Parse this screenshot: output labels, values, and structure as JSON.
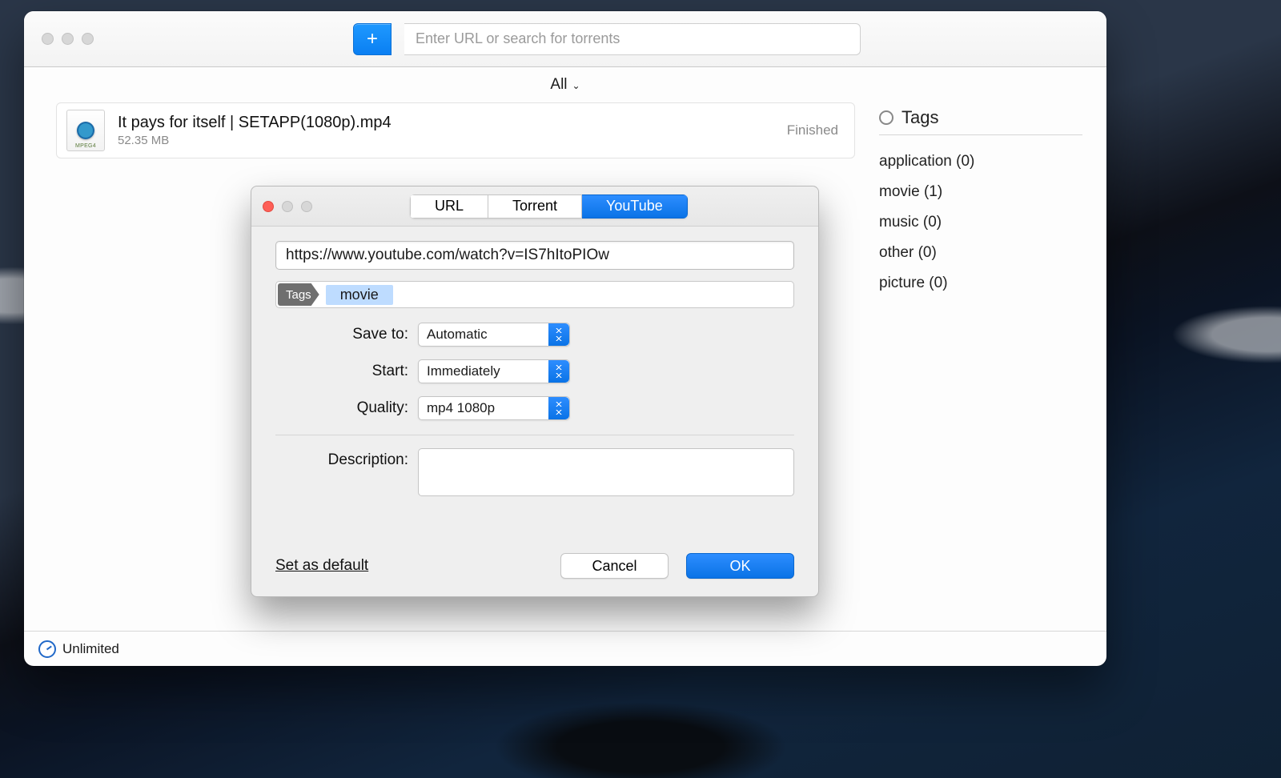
{
  "toolbar": {
    "add_symbol": "+",
    "search_placeholder": "Enter URL or search for torrents"
  },
  "filter": {
    "label": "All"
  },
  "download": {
    "title": "It pays for itself | SETAPP(1080p).mp4",
    "size": "52.35 MB",
    "status": "Finished"
  },
  "sidebar": {
    "heading": "Tags",
    "items": [
      "application (0)",
      "movie (1)",
      "music (0)",
      "other (0)",
      "picture (0)"
    ]
  },
  "bottom": {
    "speed_label": "Unlimited"
  },
  "sheet": {
    "tabs": {
      "url": "URL",
      "torrent": "Torrent",
      "youtube": "YouTube"
    },
    "url_value": "https://www.youtube.com/watch?v=IS7hItoPIOw",
    "tags_chip": "Tags",
    "tag_token": "movie",
    "labels": {
      "save_to": "Save to:",
      "start": "Start:",
      "quality": "Quality:",
      "description": "Description:"
    },
    "values": {
      "save_to": "Automatic",
      "start": "Immediately",
      "quality": "mp4 1080p",
      "description": ""
    },
    "footer": {
      "default_link": "Set as default",
      "cancel": "Cancel",
      "ok": "OK"
    }
  }
}
